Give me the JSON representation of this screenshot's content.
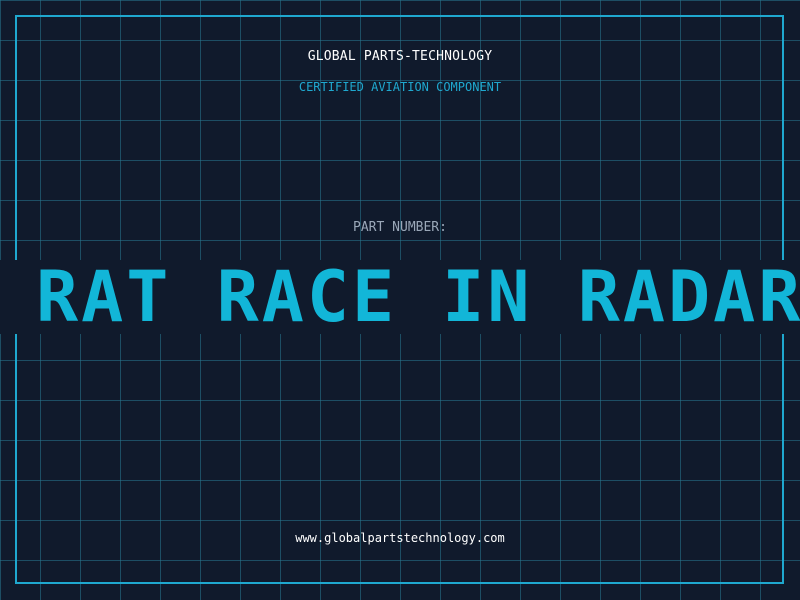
{
  "header": {
    "company": "GLOBAL PARTS-TECHNOLOGY",
    "subtitle": "CERTIFIED AVIATION COMPONENT"
  },
  "part": {
    "label": "PART NUMBER:",
    "value": "RAT RACE IN RADAR"
  },
  "footer": {
    "url": "www.globalpartstechnology.com"
  },
  "colors": {
    "background": "#101a2c",
    "accent": "#12b6d8",
    "frame": "#1fa8cf",
    "label": "#9aa7b8"
  }
}
